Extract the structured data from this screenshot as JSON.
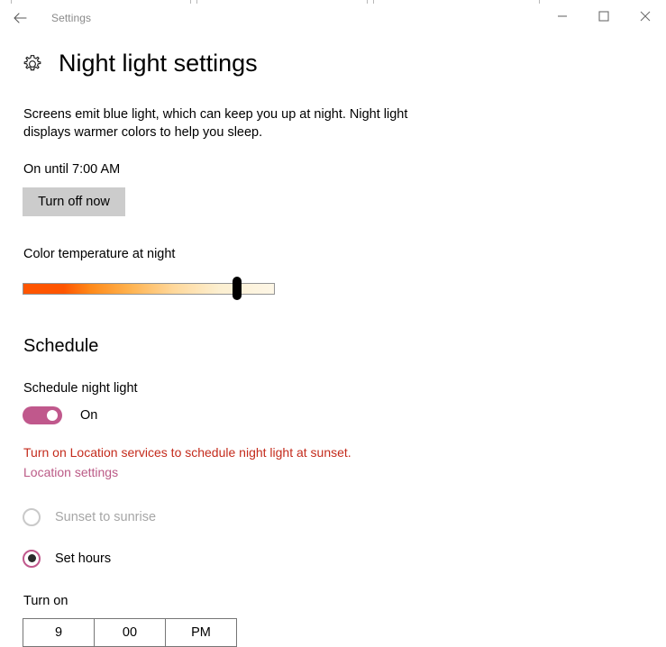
{
  "window": {
    "app_title": "Settings",
    "back_icon": "back-arrow-icon",
    "minimize_label": "—",
    "maximize_label": "□",
    "close_label": "✕"
  },
  "page": {
    "icon": "gear-icon",
    "title": "Night light settings",
    "description": "Screens emit blue light, which can keep you up at night. Night light displays warmer colors to help you sleep.",
    "status_text": "On until 7:00 AM",
    "turn_off_button": "Turn off now"
  },
  "color_temperature": {
    "label": "Color temperature at night",
    "value_percent": 83,
    "gradient_start": "#ff5500",
    "gradient_end": "#fdf6e6",
    "thumb_color": "#000000"
  },
  "schedule": {
    "section_title": "Schedule",
    "toggle_label": "Schedule night light",
    "toggle_state": "On",
    "toggle_on": true,
    "accent_color": "#c0588c",
    "warning_text": "Turn on Location services to schedule night light at sunset.",
    "warning_color": "#c42b1c",
    "location_link": "Location settings",
    "link_color": "#bb5a86",
    "options": [
      {
        "label": "Sunset to sunrise",
        "selected": false,
        "disabled": true
      },
      {
        "label": "Set hours",
        "selected": true,
        "disabled": false
      }
    ],
    "turn_on_label": "Turn on",
    "time": {
      "hour": "9",
      "minute": "00",
      "meridiem": "PM"
    }
  }
}
